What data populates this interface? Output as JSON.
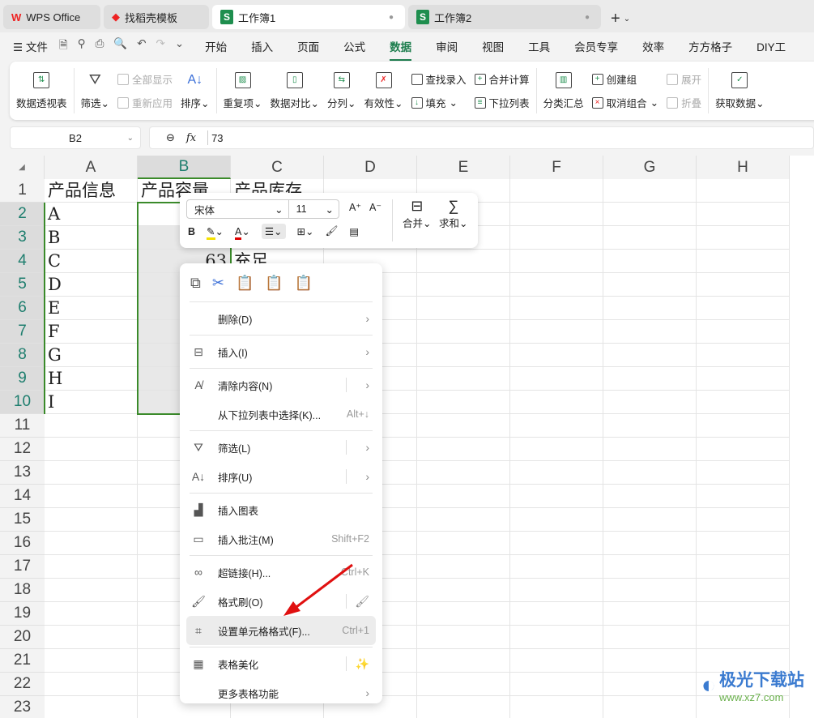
{
  "tabs": [
    {
      "label": "WPS Office",
      "icon": "wps-icon"
    },
    {
      "label": "找稻壳模板",
      "icon": "docer-icon"
    },
    {
      "label": "工作簿1",
      "icon": "sheet-icon",
      "active": true
    },
    {
      "label": "工作簿2",
      "icon": "sheet-icon"
    }
  ],
  "menubar": {
    "file": "文件",
    "items": [
      "开始",
      "插入",
      "页面",
      "公式",
      "数据",
      "审阅",
      "视图",
      "工具",
      "会员专享",
      "效率",
      "方方格子",
      "DIY工"
    ],
    "active": "数据"
  },
  "ribbon": {
    "pivot": "数据透视表",
    "filter": "筛选",
    "show_all": "全部显示",
    "reapply": "重新应用",
    "sort": "排序",
    "duplicates": "重复项",
    "compare": "数据对比",
    "split": "分列",
    "validity": "有效性",
    "lookup": "查找录入",
    "fill": "填充",
    "consolidate": "合并计算",
    "dropdown": "下拉列表",
    "subtotal": "分类汇总",
    "create_group": "创建组",
    "ungroup": "取消组合",
    "expand": "展开",
    "collapse": "折叠",
    "get_data": "获取数据"
  },
  "formula_bar": {
    "cell_ref": "B2",
    "fx": "fx",
    "value": "73"
  },
  "grid": {
    "columns": [
      "A",
      "B",
      "C",
      "D",
      "E",
      "F",
      "G",
      "H"
    ],
    "rows": 23,
    "selected_column": "B",
    "cells": [
      {
        "ref": "A1",
        "v": "产品信息"
      },
      {
        "ref": "B1",
        "v": "产品容量"
      },
      {
        "ref": "C1",
        "v": "产品库存"
      },
      {
        "ref": "A2",
        "v": "A"
      },
      {
        "ref": "A3",
        "v": "B"
      },
      {
        "ref": "A4",
        "v": "C"
      },
      {
        "ref": "A5",
        "v": "D"
      },
      {
        "ref": "A6",
        "v": "E"
      },
      {
        "ref": "A7",
        "v": "F"
      },
      {
        "ref": "A8",
        "v": "G"
      },
      {
        "ref": "A9",
        "v": "H"
      },
      {
        "ref": "A10",
        "v": "I"
      },
      {
        "ref": "B4",
        "v": "63",
        "num": true
      },
      {
        "ref": "C4",
        "v": "充足"
      }
    ]
  },
  "mini_toolbar": {
    "font": "宋体",
    "size": "11",
    "bold": "B",
    "merge": "合并",
    "sum": "求和",
    "highlight_color": "#f5e100",
    "font_color": "#e00000"
  },
  "context_menu": {
    "items": [
      {
        "label": "删除(D)",
        "icon": "",
        "arrow": true
      },
      {
        "label": "插入(I)",
        "icon": "insert-icon",
        "arrow": true,
        "sep": true
      },
      {
        "label": "清除内容(N)",
        "icon": "clear-icon",
        "arrow": true,
        "split": true,
        "sep": true
      },
      {
        "label": "从下拉列表中选择(K)...",
        "shortcut": "Alt+↓"
      },
      {
        "label": "筛选(L)",
        "icon": "filter-icon",
        "arrow": true,
        "split": true,
        "sep": true
      },
      {
        "label": "排序(U)",
        "icon": "sort-icon",
        "arrow": true,
        "split": true
      },
      {
        "label": "插入图表",
        "icon": "chart-icon",
        "sep": true
      },
      {
        "label": "插入批注(M)",
        "icon": "comment-icon",
        "shortcut": "Shift+F2"
      },
      {
        "label": "超链接(H)...",
        "icon": "link-icon",
        "shortcut": "Ctrl+K",
        "sep": true
      },
      {
        "label": "格式刷(O)",
        "icon": "format-painter-icon",
        "side": "🖌",
        "split": true
      },
      {
        "label": "设置单元格格式(F)...",
        "icon": "format-cells-icon",
        "shortcut": "Ctrl+1",
        "hover": true
      },
      {
        "label": "表格美化",
        "icon": "beautify-icon",
        "side": "✨",
        "split": true,
        "sep": true
      },
      {
        "label": "更多表格功能",
        "icon": "",
        "arrow": true
      }
    ]
  },
  "watermark": {
    "name": "极光下载站",
    "url": "www.xz7.com"
  }
}
